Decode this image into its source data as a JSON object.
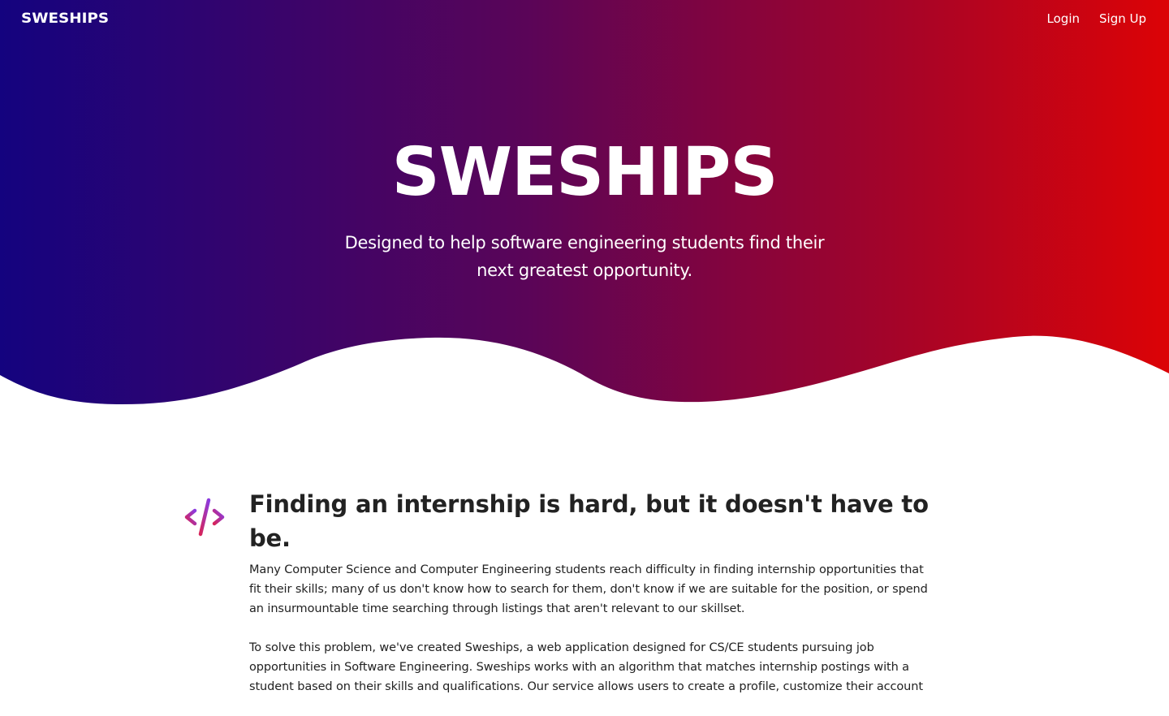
{
  "nav": {
    "logo": "SWESHIPS",
    "login_label": "Login",
    "signup_label": "Sign Up"
  },
  "hero": {
    "title": "SWESHIPS",
    "subtitle": "Designed to help software engineering students find their next greatest opportunity.",
    "gradient_start": "#14037f",
    "gradient_mid": "#5a0558",
    "gradient_end": "#dc0306"
  },
  "feature": {
    "icon": "code-icon",
    "heading": "Finding an internship is hard, but it doesn't have to be.",
    "paragraphs": [
      "Many Computer Science and Computer Engineering students reach difficulty in finding internship opportunities that fit their skills; many of us don't know how to search for them, don't know if we are suitable for the position, or spend an insurmountable time searching through listings that aren't relevant to our skillset.",
      "To solve this problem, we've created Sweships, a web application designed for CS/CE students pursuing job opportunities in Software Engineering. Sweships works with an algorithm that matches internship postings with a student based on their skills and qualifications. Our service allows users to create a profile, customize their account"
    ]
  }
}
